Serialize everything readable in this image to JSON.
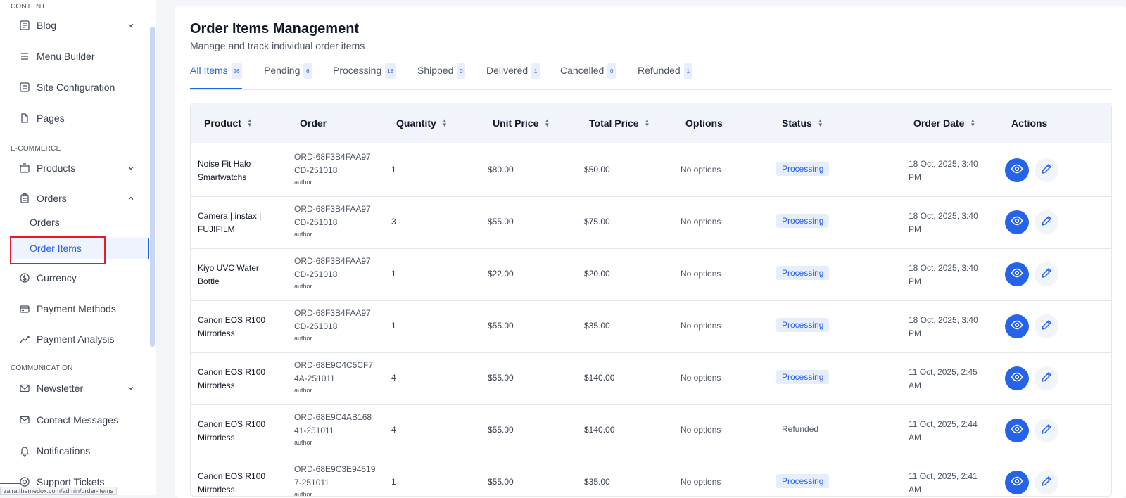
{
  "sidebar": {
    "sections": {
      "content": "CONTENT",
      "ecommerce": "E-COMMERCE",
      "communication": "COMMUNICATION"
    },
    "items": {
      "blog": "Blog",
      "menu_builder": "Menu Builder",
      "site_configuration": "Site Configuration",
      "pages": "Pages",
      "products": "Products",
      "orders": "Orders",
      "orders_sub": "Orders",
      "order_items": "Order Items",
      "currency": "Currency",
      "payment_methods": "Payment Methods",
      "payment_analysis": "Payment Analysis",
      "newsletter": "Newsletter",
      "contact_messages": "Contact Messages",
      "notifications": "Notifications",
      "support_tickets": "Support Tickets"
    },
    "status_url": "zaira.themedox.com/admin/order-items"
  },
  "page": {
    "title": "Order Items Management",
    "subtitle": "Manage and track individual order items"
  },
  "tabs": [
    {
      "label": "All Items",
      "count": "26"
    },
    {
      "label": "Pending",
      "count": "6"
    },
    {
      "label": "Processing",
      "count": "18"
    },
    {
      "label": "Shipped",
      "count": "0"
    },
    {
      "label": "Delivered",
      "count": "1"
    },
    {
      "label": "Cancelled",
      "count": "0"
    },
    {
      "label": "Refunded",
      "count": "1"
    }
  ],
  "table": {
    "headers": {
      "product": "Product",
      "order": "Order",
      "quantity": "Quantity",
      "unit_price": "Unit Price",
      "total_price": "Total Price",
      "options": "Options",
      "status": "Status",
      "order_date": "Order Date",
      "actions": "Actions"
    },
    "rows": [
      {
        "product_1": "Noise Fit Halo",
        "product_2": "Smartwatchs",
        "order_1": "ORD-68F3B4FAA97",
        "order_2": "CD-251018",
        "by": "author",
        "quantity": "1",
        "unit_price": "$80.00",
        "total_price": "$50.00",
        "options": "No options",
        "status": "Processing",
        "date_1": "18 Oct, 2025, 3:40",
        "date_2": "PM"
      },
      {
        "product_1": "Camera | instax |",
        "product_2": "FUJIFILM",
        "order_1": "ORD-68F3B4FAA97",
        "order_2": "CD-251018",
        "by": "author",
        "quantity": "3",
        "unit_price": "$55.00",
        "total_price": "$75.00",
        "options": "No options",
        "status": "Processing",
        "date_1": "18 Oct, 2025, 3:40",
        "date_2": "PM"
      },
      {
        "product_1": "Kiyo UVC Water",
        "product_2": "Bottle",
        "order_1": "ORD-68F3B4FAA97",
        "order_2": "CD-251018",
        "by": "author",
        "quantity": "1",
        "unit_price": "$22.00",
        "total_price": "$20.00",
        "options": "No options",
        "status": "Processing",
        "date_1": "18 Oct, 2025, 3:40",
        "date_2": "PM"
      },
      {
        "product_1": "Canon EOS R100",
        "product_2": "Mirrorless",
        "order_1": "ORD-68F3B4FAA97",
        "order_2": "CD-251018",
        "by": "author",
        "quantity": "1",
        "unit_price": "$55.00",
        "total_price": "$35.00",
        "options": "No options",
        "status": "Processing",
        "date_1": "18 Oct, 2025, 3:40",
        "date_2": "PM"
      },
      {
        "product_1": "Canon EOS R100",
        "product_2": "Mirrorless",
        "order_1": "ORD-68E9C4C5CF7",
        "order_2": "4A-251011",
        "by": "author",
        "quantity": "4",
        "unit_price": "$55.00",
        "total_price": "$140.00",
        "options": "No options",
        "status": "Processing",
        "date_1": "11 Oct, 2025, 2:45",
        "date_2": "AM"
      },
      {
        "product_1": "Canon EOS R100",
        "product_2": "Mirrorless",
        "order_1": "ORD-68E9C4AB168",
        "order_2": "41-251011",
        "by": "author",
        "quantity": "4",
        "unit_price": "$55.00",
        "total_price": "$140.00",
        "options": "No options",
        "status": "Refunded",
        "date_1": "11 Oct, 2025, 2:44",
        "date_2": "AM"
      },
      {
        "product_1": "Canon EOS R100",
        "product_2": "Mirrorless",
        "order_1": "ORD-68E9C3E94519",
        "order_2": "7-251011",
        "by": "author",
        "quantity": "1",
        "unit_price": "$55.00",
        "total_price": "$35.00",
        "options": "No options",
        "status": "Processing",
        "date_1": "11 Oct, 2025, 2:41",
        "date_2": "AM"
      }
    ]
  },
  "colors": {
    "accent": "#2563eb",
    "highlight": "#e11d2a",
    "badge_bg": "#e6edfb"
  }
}
